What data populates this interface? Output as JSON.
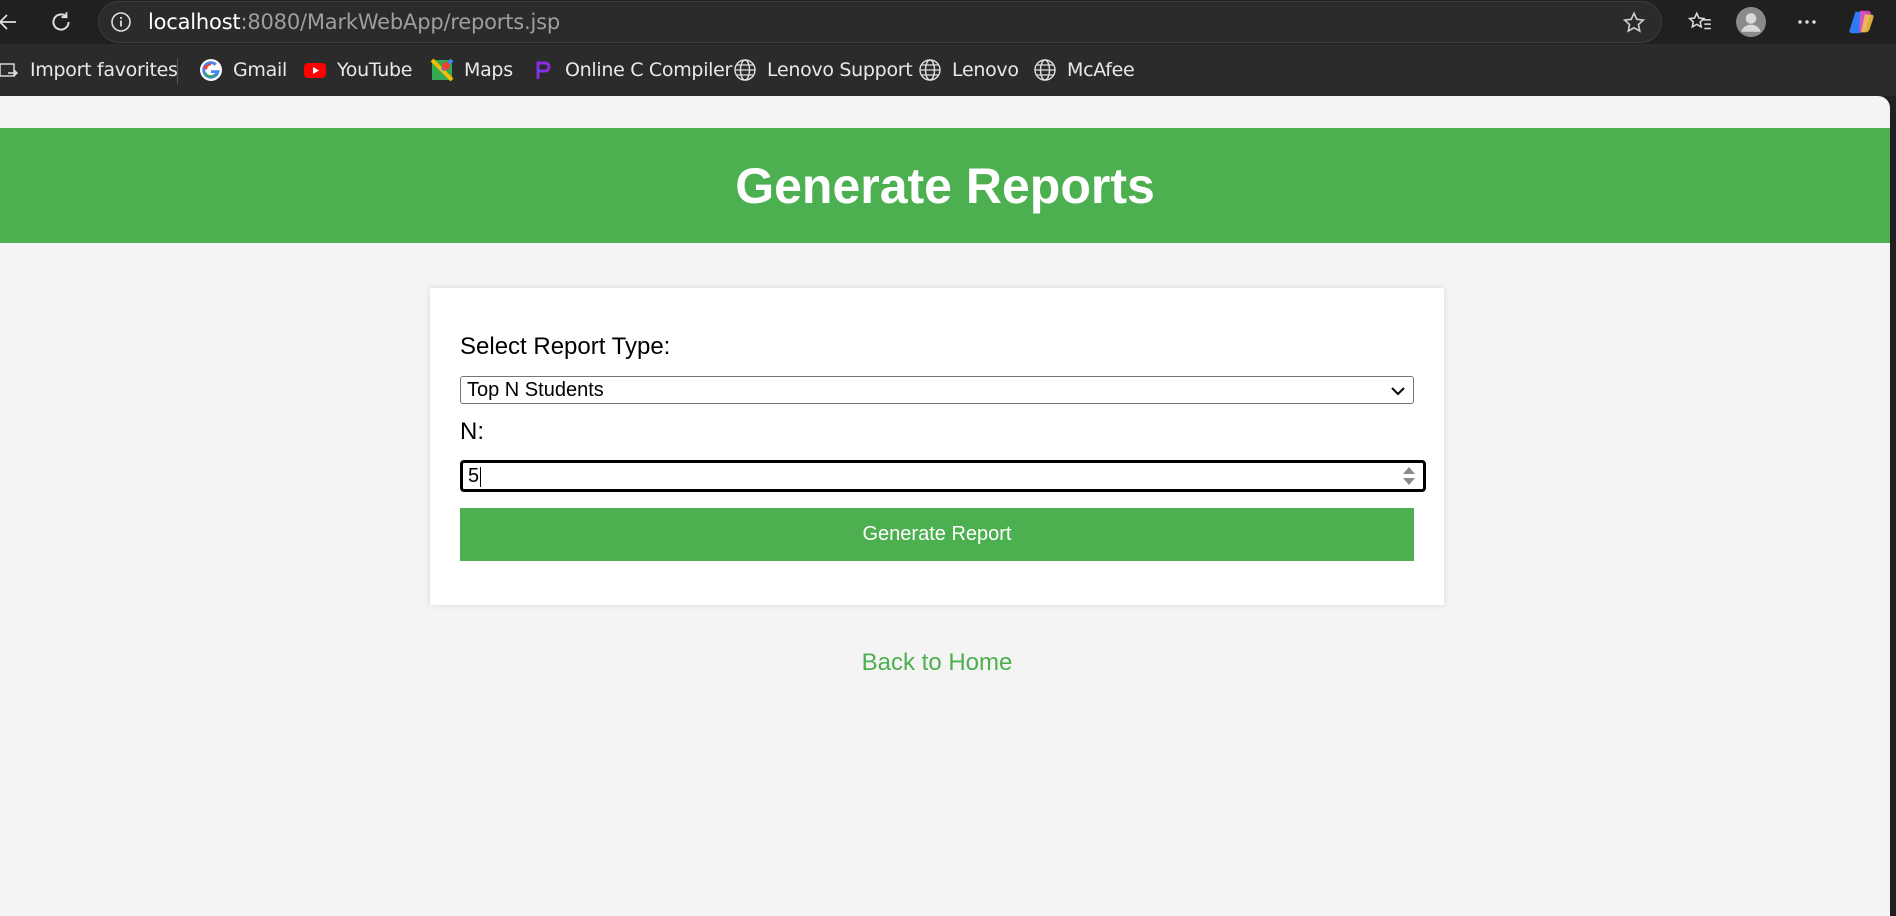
{
  "browser": {
    "url_host": "localhost",
    "url_path": ":8080/MarkWebApp/reports.jsp",
    "icons": [
      "back-arrow-icon",
      "refresh-icon",
      "site-info-icon",
      "favorite-star-icon",
      "favorites-icon",
      "profile-icon",
      "more-icon",
      "copilot-icon"
    ]
  },
  "bookmarks": [
    {
      "label": "Import favorites",
      "icon": "import-icon"
    },
    {
      "label": "Gmail",
      "icon": "google-icon"
    },
    {
      "label": "YouTube",
      "icon": "youtube-icon"
    },
    {
      "label": "Maps",
      "icon": "maps-icon"
    },
    {
      "label": "Online C Compiler",
      "icon": "compiler-icon"
    },
    {
      "label": "Lenovo Support",
      "icon": "globe-icon"
    },
    {
      "label": "Lenovo",
      "icon": "globe-icon"
    },
    {
      "label": "McAfee",
      "icon": "globe-icon"
    }
  ],
  "page": {
    "title": "Generate Reports",
    "report_type_label": "Select Report Type:",
    "report_type_value": "Top N Students",
    "n_label": "N:",
    "n_value": "5",
    "generate_button": "Generate Report",
    "back_link": "Back to Home"
  },
  "colors": {
    "accent": "#4caf50",
    "page_bg": "#f4f4f4",
    "browser_bg": "#202020"
  }
}
